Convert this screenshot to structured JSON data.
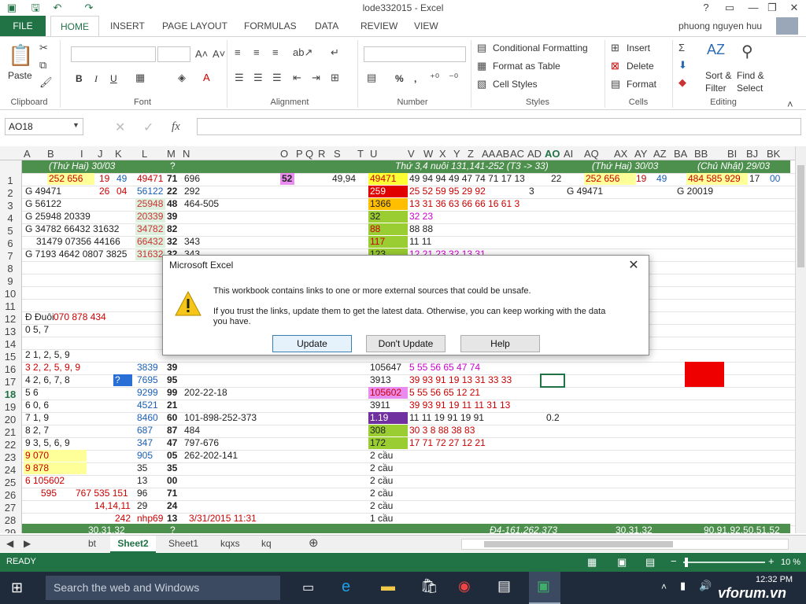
{
  "window": {
    "title": "lode332015  -  Excel",
    "help": "?"
  },
  "ribbon_tabs": [
    "FILE",
    "HOME",
    "INSERT",
    "PAGE LAYOUT",
    "FORMULAS",
    "DATA",
    "REVIEW",
    "VIEW"
  ],
  "user": "phuong nguyen huu",
  "ribbon": {
    "paste": "Paste",
    "bold": "B",
    "italic": "I",
    "underline": "U",
    "percent": "%",
    "comma": ",",
    "conditional_formatting": "Conditional Formatting",
    "format_as_table": "Format as Table",
    "cell_styles": "Cell Styles",
    "insert": "Insert",
    "delete": "Delete",
    "format": "Format",
    "sort_filter": "Sort &",
    "sort_filter2": "Filter",
    "find_select": "Find &",
    "find_select2": "Select",
    "groups": [
      "Clipboard",
      "Font",
      "Alignment",
      "Number",
      "Styles",
      "Cells",
      "Editing"
    ]
  },
  "formula_bar": {
    "name_box": "AO18",
    "fx": "fx"
  },
  "columns": [
    "A",
    "B",
    "I",
    "J",
    "K",
    "L",
    "M",
    "N",
    "O",
    "P",
    "Q",
    "R",
    "S",
    "T",
    "U",
    "V",
    "W",
    "X",
    "Y",
    "Z",
    "AA",
    "AB",
    "AC",
    "AD",
    "AO",
    "AI",
    "AQ",
    "AX",
    "AY",
    "AZ",
    "BA",
    "BB",
    "BI",
    "BJ",
    "BK"
  ],
  "rows": [
    "1",
    "2",
    "3",
    "4",
    "5",
    "6",
    "7",
    "8",
    "9",
    "10",
    "11",
    "12",
    "13",
    "14",
    "15",
    "16",
    "17",
    "18",
    "19",
    "20",
    "21",
    "22",
    "23",
    "24",
    "25",
    "26",
    "27",
    "28",
    "29"
  ],
  "cells": {
    "r1_b": "(Thứ Hai)  30/03",
    "r1_m": "?",
    "r1_u": "Thứ 3,4 nuôi 131,141-252 (T3 -> 33)",
    "r1_aq": "(Thứ Hai)  30/03",
    "r1_bb": "(Chủ Nhật)  29/03",
    "r2_b": "252 656",
    "r2_j": "19",
    "r2_k": "49",
    "r2_l": "49471",
    "r2_m": "71",
    "r2_n": "696",
    "r2_o": "52",
    "r2_s": "49,94",
    "r2_u": "49471",
    "r2_v": "49 94 94 49 47 74 71 17 13",
    "r2_ao": "22",
    "r2_aq": "252 656",
    "r2_ax": "19",
    "r2_az": "49",
    "r2_bb": "484 585 929",
    "r2_bj": "17",
    "r2_bk": "00",
    "r3_b": "G 49471",
    "r3_j": "26",
    "r3_k": "04",
    "r3_l": "56122",
    "r3_m": "22",
    "r3_n": "292",
    "r3_u": "259",
    "r3_v": "25 52 59 95 29 92",
    "r3_ad": "3",
    "r3_aq": "G 49471",
    "r3_bb": "G 20019",
    "r4_b": "G 56122",
    "r4_l": "25948",
    "r4_m": "48",
    "r4_n": "464-505",
    "r4_u": "1366",
    "r4_v": "13 31 36 63 66 66 16 61 3",
    "r5_b": "G 25948 20339",
    "r5_l": "20339",
    "r5_m": "39",
    "r5_u": "32",
    "r5_v": "32 23",
    "r6_b": "G 34782 66432 31632",
    "r6_l": "34782",
    "r6_m": "82",
    "r6_u": "88",
    "r6_v": "88 88",
    "r7_b": "31479 07356 44166",
    "r7_l": "66432",
    "r7_m": "32",
    "r7_n": "343",
    "r7_u": "117",
    "r7_v": "11 11",
    "r8_b": "G 7193 4642 0807 3825",
    "r8_l": "31632",
    "r8_m": "32",
    "r8_n": "343",
    "r8_u": "123",
    "r8_v": "12 21 23 32 13 31",
    "r13_b": "Đ Đuôi",
    "r13_i": "070 878 434",
    "r14_b": "0 5, 7",
    "r16_b": "2 1, 2, 5, 9",
    "r17_b": "3 2, 2, 5, 9, 9",
    "r17_l": "3839",
    "r17_m": "39",
    "r17_u": "105647",
    "r17_v": "5  55 56 65 47 74",
    "r18_b": "4 2, 6, 7, 8",
    "r18_k": "?",
    "r18_l": "7695",
    "r18_m": "95",
    "r18_u": "3913",
    "r18_v": "39 93 91 19 13 31 33 33",
    "r19_b": "5 6",
    "r19_l": "9299",
    "r19_m": "99",
    "r19_n": "202-22-18",
    "r19_u": "105602",
    "r19_v": "5  55 56 65 12 21",
    "r20_b": "6 0, 6",
    "r20_l": "4521",
    "r20_m": "21",
    "r20_u": "3911",
    "r20_v": "39 93 91 19 11 11 31 13",
    "r21_b": "7 1, 9",
    "r21_l": "8460",
    "r21_m": "60",
    "r21_n": "101-898-252-373",
    "r21_u": "1.19",
    "r21_v": "11 11 19 91 19 91",
    "r21_ao": "0.2",
    "r22_b": "8 2, 7",
    "r22_l": "687",
    "r22_m": "87",
    "r22_n": "484",
    "r22_u": "308",
    "r22_v": "30 3  8  88 38 83",
    "r23_b": "9 3, 5, 6, 9",
    "r23_l": "347",
    "r23_m": "47",
    "r23_n": "797-676",
    "r23_u": "172",
    "r23_v": "17 71 72 27 12 21",
    "r24_b": "9  070",
    "r24_l": "905",
    "r24_m": "05",
    "r24_n": "262-202-141",
    "r24_u": "2 cầu",
    "r25_b": "9  878",
    "r25_l": "35",
    "r25_m": "35",
    "r25_u": "2 cầu",
    "r26_b": "6  105602",
    "r26_l": "13",
    "r26_m": "00",
    "r26_u": "2 cầu",
    "r27_b": "595",
    "r27_i": "767 535 151",
    "r27_l": "96",
    "r27_m": "71",
    "r27_u": "2 cầu",
    "r28_i": "14,14,11",
    "r28_l": "29",
    "r28_m": "24",
    "r28_u": "2 cầu",
    "r29_k": "242",
    "r29_l": "nhp69",
    "r29_m": "13",
    "r29_n": "3/31/2015 11:31",
    "r29_u": "1 cầu",
    "r30_b": "30,31,32",
    "r30_m": "?",
    "r30_v": "Đ4-161,262,373",
    "r30_aq": "30,31,32",
    "r30_bb": "90,91,92,50,51,52"
  },
  "dialog": {
    "title": "Microsoft Excel",
    "line1": "This workbook contains links to one or more external sources that could be unsafe.",
    "line2": "If you trust the links, update them to get the latest data. Otherwise, you can keep working with the data",
    "line3": "you have.",
    "btn_update": "Update",
    "btn_dont_update": "Don't Update",
    "btn_help": "Help"
  },
  "sheet_tabs": [
    "bt",
    "Sheet2",
    "Sheet1",
    "kqxs",
    "kq"
  ],
  "status": {
    "ready": "READY",
    "zoom": "10 %"
  },
  "taskbar": {
    "search": "Search the web and Windows",
    "time": "12:32 PM",
    "watermark": "vforum.vn"
  },
  "colors": {
    "excel_green": "#217346",
    "band_green": "#4d8f4d"
  }
}
